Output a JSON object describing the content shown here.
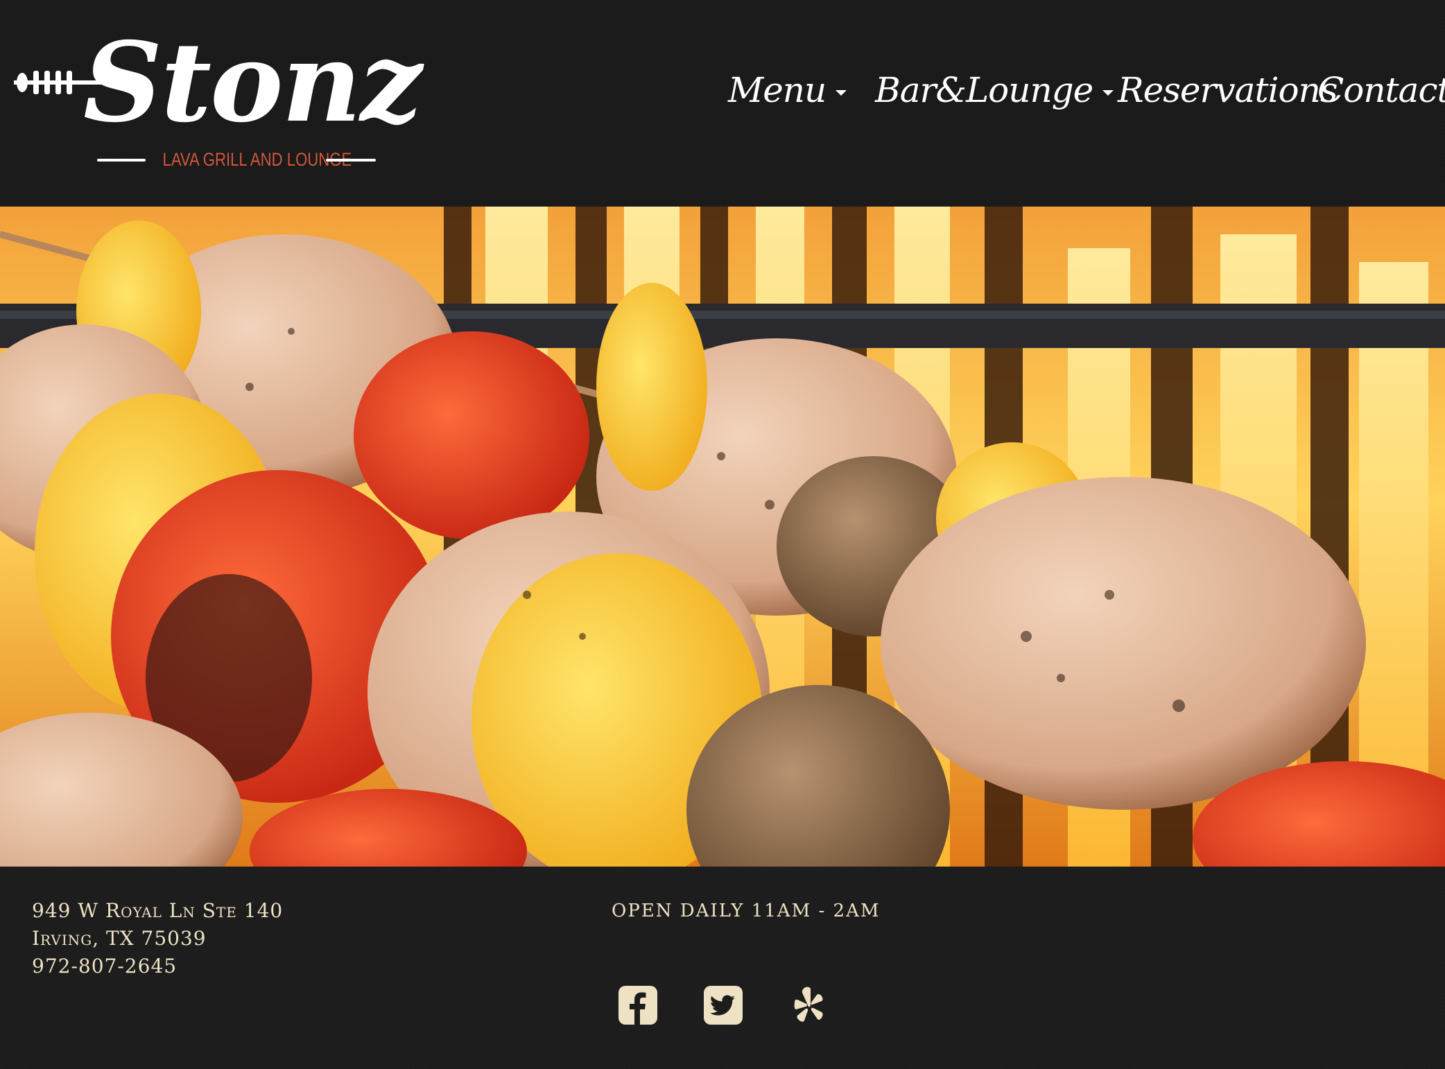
{
  "brand": {
    "name": "Stonz",
    "tagline": "LAVA GRILL AND LOUNGE",
    "accent_color": "#d3573c",
    "text_color": "#ffffff"
  },
  "nav": {
    "items": [
      {
        "label": "Menu",
        "has_dropdown": true
      },
      {
        "label": "Bar&Lounge",
        "has_dropdown": true
      },
      {
        "label": "Reservations",
        "has_dropdown": false
      },
      {
        "label": "Contact",
        "has_dropdown": false
      }
    ]
  },
  "hero": {
    "subject": "grilled kebab skewers over flames"
  },
  "footer": {
    "address_line1": "949 W Royal Ln Ste 140",
    "address_line2": "Irving, TX 75039",
    "phone": "972-807-2645",
    "hours": "OPEN DAILY 11AM - 2AM",
    "text_color": "#efe2c4",
    "social": [
      {
        "icon": "facebook-icon"
      },
      {
        "icon": "twitter-icon"
      },
      {
        "icon": "yelp-icon"
      }
    ]
  }
}
